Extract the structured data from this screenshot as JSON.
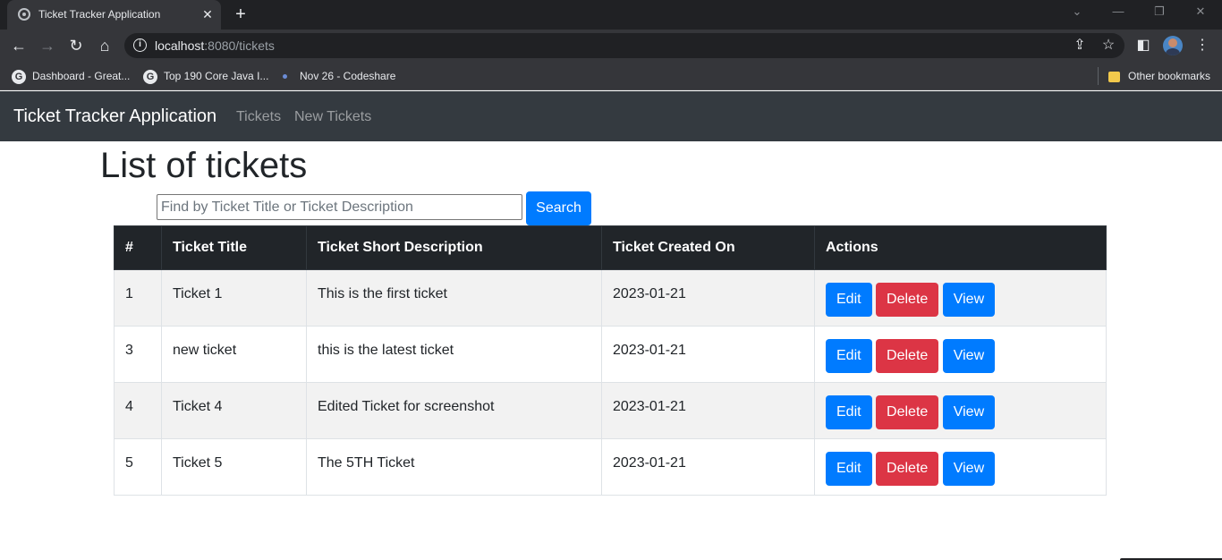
{
  "browser": {
    "tab_title": "Ticket Tracker Application",
    "url_host": "localhost",
    "url_rest": ":8080/tickets",
    "bookmarks": [
      {
        "label": "Dashboard - Great...",
        "icon": "google-icon"
      },
      {
        "label": "Top 190 Core Java I...",
        "icon": "google-icon"
      },
      {
        "label": "Nov 26 - Codeshare",
        "icon": "dot-icon"
      }
    ],
    "other_bookmarks": "Other bookmarks"
  },
  "navbar": {
    "brand": "Ticket Tracker Application",
    "links": [
      "Tickets",
      "New Tickets"
    ]
  },
  "page": {
    "title": "List of tickets",
    "search_placeholder": "Find by Ticket Title or Ticket Description",
    "search_value": "",
    "search_button": "Search"
  },
  "table": {
    "headers": [
      "#",
      "Ticket Title",
      "Ticket Short Description",
      "Ticket Created On",
      "Actions"
    ],
    "rows": [
      {
        "id": "1",
        "title": "Ticket 1",
        "description": "This is the first ticket",
        "created": "2023-01-21"
      },
      {
        "id": "3",
        "title": "new ticket",
        "description": "this is the latest ticket",
        "created": "2023-01-21"
      },
      {
        "id": "4",
        "title": "Ticket 4",
        "description": "Edited Ticket for screenshot",
        "created": "2023-01-21"
      },
      {
        "id": "5",
        "title": "Ticket 5",
        "description": "The 5TH Ticket",
        "created": "2023-01-21"
      }
    ],
    "actions": {
      "edit": "Edit",
      "delete": "Delete",
      "view": "View"
    }
  },
  "colors": {
    "navbar_bg": "#343a40",
    "primary": "#007bff",
    "danger": "#dc3545",
    "table_header_bg": "#212529",
    "striped_row": "#f2f2f2"
  }
}
